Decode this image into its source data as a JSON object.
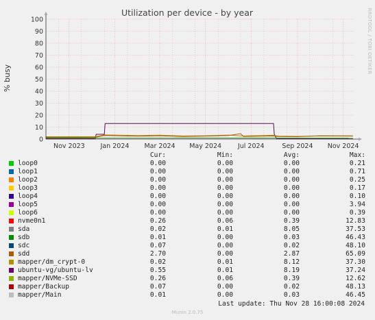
{
  "chart_data": {
    "type": "line",
    "title": "Utilization per device - by year",
    "ylabel": "% busy",
    "xlabel": "",
    "ylim": [
      0,
      100
    ],
    "yticks": [
      0,
      10,
      20,
      30,
      40,
      50,
      60,
      70,
      80,
      90,
      100
    ],
    "xlim": [
      "2023-10-15",
      "2024-11-30"
    ],
    "xticks": [
      {
        "date": "2023-11-15",
        "label": "Nov 2023"
      },
      {
        "date": "2024-01-15",
        "label": "Jan 2024"
      },
      {
        "date": "2024-03-15",
        "label": "Mar 2024"
      },
      {
        "date": "2024-05-15",
        "label": "May 2024"
      },
      {
        "date": "2024-07-15",
        "label": "Jul 2024"
      },
      {
        "date": "2024-09-15",
        "label": "Sep 2024"
      },
      {
        "date": "2024-11-15",
        "label": "Nov 2024"
      }
    ],
    "grid": true,
    "series": [
      {
        "name": "ubuntu-vg/ubuntu-lv",
        "color": "#5a0a5a",
        "points": [
          [
            "2023-10-15",
            0.5
          ],
          [
            "2023-12-20",
            0.5
          ],
          [
            "2023-12-21",
            4
          ],
          [
            "2024-01-01",
            4
          ],
          [
            "2024-01-02",
            13
          ],
          [
            "2024-08-14",
            13
          ],
          [
            "2024-08-15",
            4
          ],
          [
            "2024-08-18",
            0.5
          ],
          [
            "2024-11-28",
            0.5
          ]
        ]
      },
      {
        "name": "mapper/dm_crypt-0",
        "color": "#b8860b",
        "points": [
          [
            "2023-10-15",
            2
          ],
          [
            "2023-12-20",
            2
          ],
          [
            "2024-01-01",
            3.5
          ],
          [
            "2024-02-15",
            3
          ],
          [
            "2024-03-15",
            3.3
          ],
          [
            "2024-04-15",
            2.6
          ],
          [
            "2024-05-15",
            2.8
          ],
          [
            "2024-06-15",
            3.4
          ],
          [
            "2024-07-01",
            2.6
          ],
          [
            "2024-08-14",
            3.2
          ],
          [
            "2024-08-20",
            2.5
          ],
          [
            "2024-09-15",
            2.3
          ],
          [
            "2024-10-15",
            2.6
          ],
          [
            "2024-11-28",
            2.5
          ]
        ]
      },
      {
        "name": "sdd",
        "color": "#b05a00",
        "points": [
          [
            "2023-10-15",
            1.5
          ],
          [
            "2023-12-20",
            1.5
          ],
          [
            "2024-01-01",
            3
          ],
          [
            "2024-02-15",
            2.4
          ],
          [
            "2024-03-15",
            2.8
          ],
          [
            "2024-04-15",
            2.2
          ],
          [
            "2024-05-15",
            2.5
          ],
          [
            "2024-06-15",
            3
          ],
          [
            "2024-07-01",
            4.5
          ],
          [
            "2024-07-05",
            2.2
          ],
          [
            "2024-08-14",
            2.6
          ],
          [
            "2024-08-20",
            2.2
          ],
          [
            "2024-09-15",
            2.0
          ],
          [
            "2024-10-15",
            2.8
          ],
          [
            "2024-11-28",
            2.7
          ]
        ]
      },
      {
        "name": "sda",
        "color": "#228b22",
        "points": [
          [
            "2023-10-15",
            1
          ],
          [
            "2024-11-28",
            0.8
          ]
        ]
      }
    ],
    "legend": {
      "headers": [
        "Cur:",
        "Min:",
        "Avg:",
        "Max:"
      ],
      "rows": [
        {
          "name": "loop0",
          "color": "#00cc00",
          "cur": "0.00",
          "min": "0.00",
          "avg": "0.00",
          "max": "0.21"
        },
        {
          "name": "loop1",
          "color": "#0066b3",
          "cur": "0.00",
          "min": "0.00",
          "avg": "0.00",
          "max": "0.71"
        },
        {
          "name": "loop2",
          "color": "#ff8000",
          "cur": "0.00",
          "min": "0.00",
          "avg": "0.00",
          "max": "0.25"
        },
        {
          "name": "loop3",
          "color": "#ffcc00",
          "cur": "0.00",
          "min": "0.00",
          "avg": "0.00",
          "max": "0.17"
        },
        {
          "name": "loop4",
          "color": "#330099",
          "cur": "0.00",
          "min": "0.00",
          "avg": "0.00",
          "max": "0.10"
        },
        {
          "name": "loop5",
          "color": "#990099",
          "cur": "0.00",
          "min": "0.00",
          "avg": "0.00",
          "max": "3.94"
        },
        {
          "name": "loop6",
          "color": "#ccff00",
          "cur": "0.00",
          "min": "0.00",
          "avg": "0.00",
          "max": "0.39"
        },
        {
          "name": "nvme0n1",
          "color": "#ff0000",
          "cur": "0.26",
          "min": "0.06",
          "avg": "0.39",
          "max": "12.83"
        },
        {
          "name": "sda",
          "color": "#808080",
          "cur": "0.02",
          "min": "0.01",
          "avg": "8.05",
          "max": "37.53"
        },
        {
          "name": "sdb",
          "color": "#008f00",
          "cur": "0.01",
          "min": "0.00",
          "avg": "0.03",
          "max": "46.43"
        },
        {
          "name": "sdc",
          "color": "#00487d",
          "cur": "0.07",
          "min": "0.00",
          "avg": "0.02",
          "max": "48.10"
        },
        {
          "name": "sdd",
          "color": "#b35a00",
          "cur": "2.70",
          "min": "0.00",
          "avg": "2.87",
          "max": "65.09"
        },
        {
          "name": "mapper/dm_crypt-0",
          "color": "#b38f00",
          "cur": "0.02",
          "min": "0.01",
          "avg": "8.12",
          "max": "37.30"
        },
        {
          "name": "ubuntu-vg/ubuntu-lv",
          "color": "#6b006b",
          "cur": "0.55",
          "min": "0.01",
          "avg": "8.19",
          "max": "37.24"
        },
        {
          "name": "mapper/NVMe-SSD",
          "color": "#8fb300",
          "cur": "0.26",
          "min": "0.06",
          "avg": "0.39",
          "max": "12.62"
        },
        {
          "name": "mapper/Backup",
          "color": "#b30000",
          "cur": "0.07",
          "min": "0.00",
          "avg": "0.02",
          "max": "48.13"
        },
        {
          "name": "mapper/Main",
          "color": "#bebebe",
          "cur": "0.01",
          "min": "0.00",
          "avg": "0.03",
          "max": "46.45"
        }
      ]
    }
  },
  "side_label": "RRDTOOL / TOBI OETIKER",
  "last_update": "Last update: Thu Nov 28 16:00:08 2024",
  "footer": "Munin 2.0.75"
}
